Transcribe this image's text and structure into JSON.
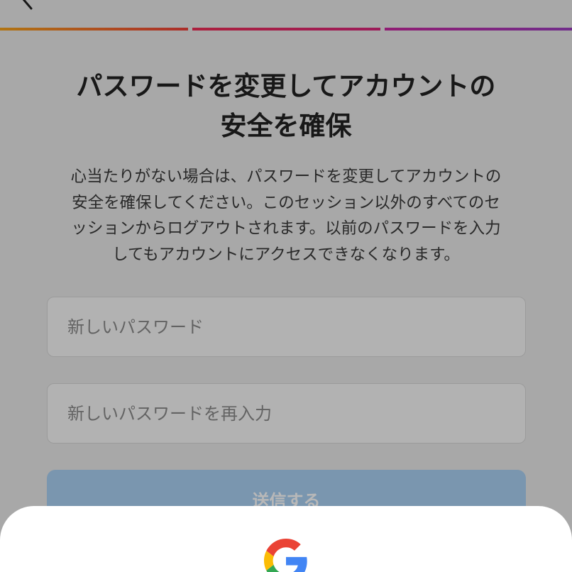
{
  "header": {
    "back_icon": "chevron-left-icon",
    "progress": {
      "total_steps": 3,
      "colors": [
        "#f5a21a",
        "#ee2d55",
        "#9d3ec0"
      ]
    }
  },
  "main": {
    "title_line1": "パスワードを変更してアカウントの",
    "title_line2": "安全を確保",
    "description_lines": [
      "心当たりがない場合は、パスワードを変更してアカウントの",
      "安全を確保してください。このセッション以外のすべてのセ",
      "ッションからログアウトされます。以前のパスワードを入力",
      "してもアカウントにアクセスできなくなります。"
    ],
    "new_password": {
      "value": "",
      "placeholder": "新しいパスワード"
    },
    "confirm_password": {
      "value": "",
      "placeholder": "新しいパスワードを再入力"
    },
    "submit_label": "送信する",
    "submit_color": "#a9d0f3"
  },
  "bottom_sheet": {
    "logo_icon": "google-logo-icon"
  }
}
